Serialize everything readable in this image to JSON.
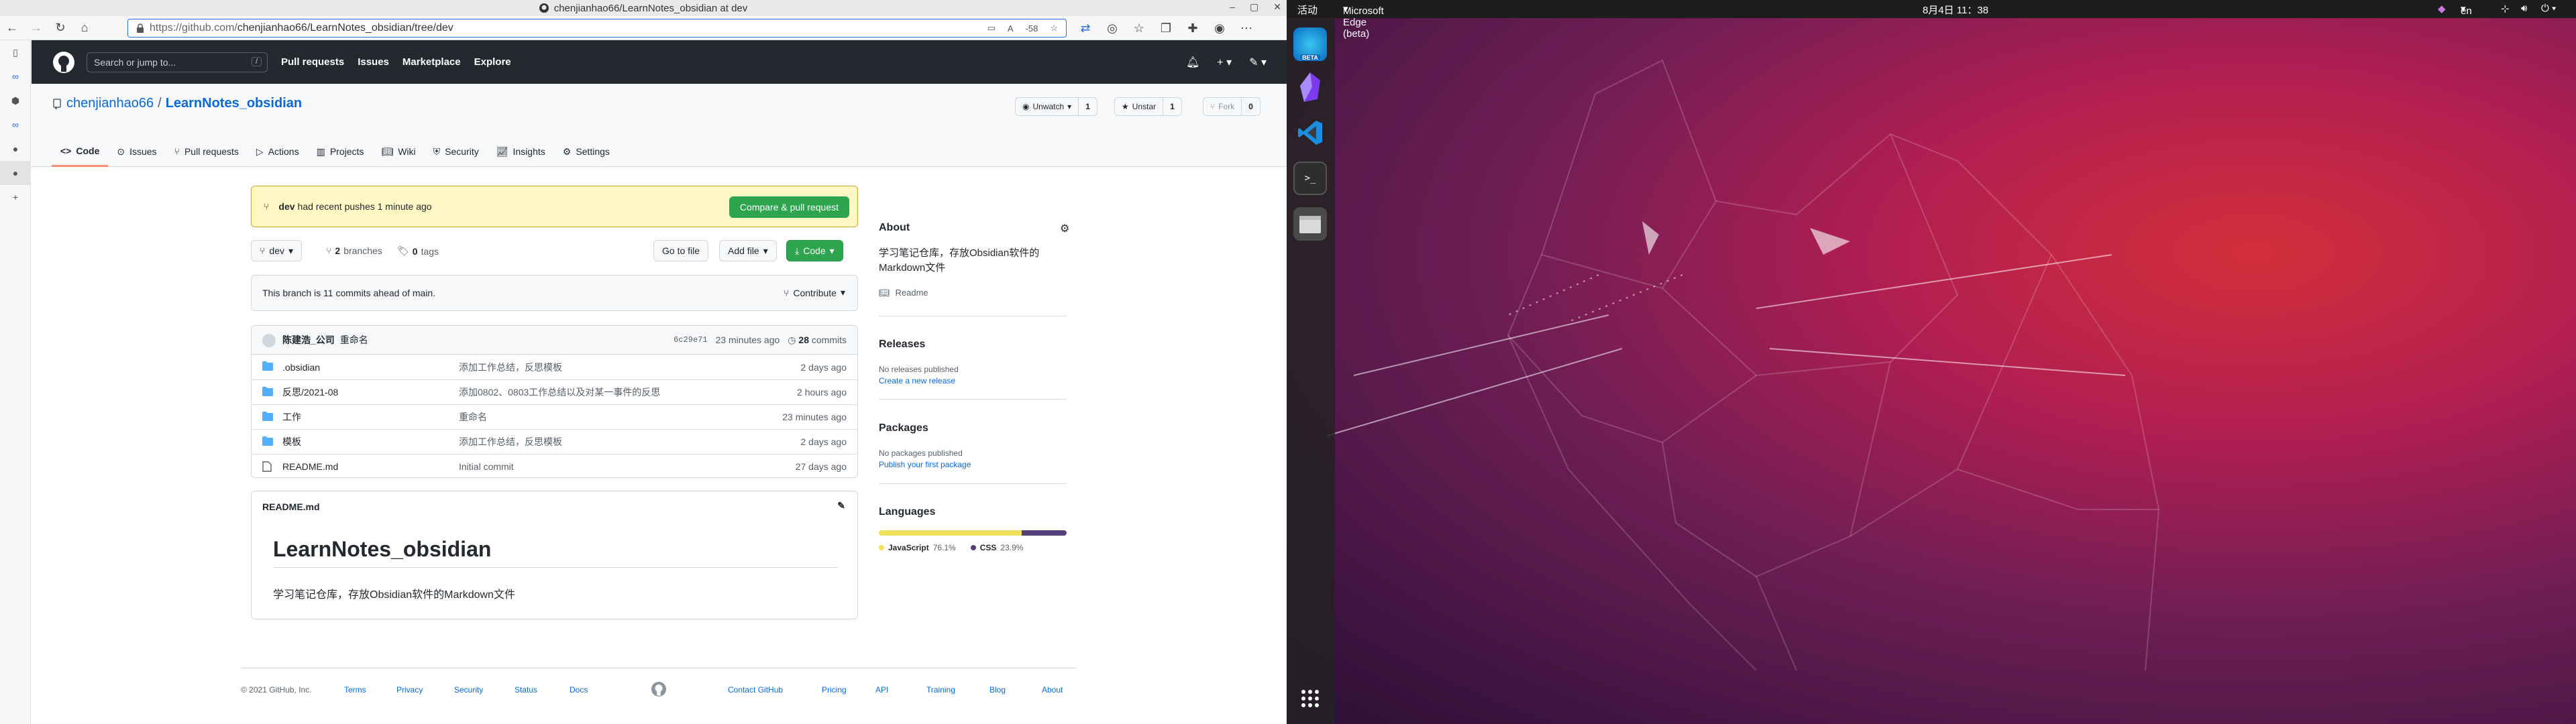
{
  "browser": {
    "window_title": "chenjianhao66/LearnNotes_obsidian at dev",
    "url_host": "https://github.com/",
    "url_path": "chenjianhao66/LearnNotes_obsidian/tree/dev",
    "zoom": "-58"
  },
  "gh": {
    "search_placeholder": "Search or jump to...",
    "search_key": "/",
    "nav": [
      "Pull requests",
      "Issues",
      "Marketplace",
      "Explore"
    ]
  },
  "repo": {
    "owner": "chenjianhao66",
    "sep": "/",
    "name": "LearnNotes_obsidian",
    "unwatch_label": "Unwatch",
    "unwatch_count": "1",
    "unstar_label": "Unstar",
    "unstar_count": "1",
    "fork_label": "Fork",
    "fork_count": "0",
    "tabs": [
      "Code",
      "Issues",
      "Pull requests",
      "Actions",
      "Projects",
      "Wiki",
      "Security",
      "Insights",
      "Settings"
    ]
  },
  "push": {
    "branch": "dev",
    "message": "had recent pushes 1 minute ago",
    "button": "Compare & pull request"
  },
  "branchbar": {
    "branch": "dev",
    "branches_count": "2",
    "branches_label": "branches",
    "tags_count": "0",
    "tags_label": "tags",
    "go_to_file": "Go to file",
    "add_file": "Add file",
    "code": "Code"
  },
  "ahead": {
    "text": "This branch is 11 commits ahead of main.",
    "contribute": "Contribute"
  },
  "last_commit": {
    "author": "陈建浩_公司",
    "message": "重命名",
    "sha": "6c29e71",
    "time": "23 minutes ago",
    "count": "28",
    "count_label": "commits"
  },
  "files": [
    {
      "type": "dir",
      "name": ".obsidian",
      "message": "添加工作总结，反思模板",
      "time": "2 days ago"
    },
    {
      "type": "dir",
      "name": "反思/2021-08",
      "message": "添加0802、0803工作总结以及对某一事件的反思",
      "time": "2 hours ago"
    },
    {
      "type": "dir",
      "name": "工作",
      "message": "重命名",
      "time": "23 minutes ago"
    },
    {
      "type": "dir",
      "name": "模板",
      "message": "添加工作总结，反思模板",
      "time": "2 days ago"
    },
    {
      "type": "file",
      "name": "README.md",
      "message": "Initial commit",
      "time": "27 days ago"
    }
  ],
  "readme": {
    "filename": "README.md",
    "title": "LearnNotes_obsidian",
    "body": "学习笔记仓库，存放Obsidian软件的Markdown文件"
  },
  "about": {
    "heading": "About",
    "description": "学习笔记仓库，存放Obsidian软件的Markdown文件",
    "readme_link": "Readme",
    "releases_heading": "Releases",
    "releases_text": "No releases published",
    "releases_link": "Create a new release",
    "packages_heading": "Packages",
    "packages_text": "No packages published",
    "packages_link": "Publish your first package",
    "languages_heading": "Languages",
    "languages": [
      {
        "name": "JavaScript",
        "percent": "76.1%",
        "value": 76.1,
        "color": "#f1e05a"
      },
      {
        "name": "CSS",
        "percent": "23.9%",
        "value": 23.9,
        "color": "#563d7c"
      }
    ]
  },
  "footer": {
    "copyright": "© 2021 GitHub, Inc.",
    "links": [
      "Terms",
      "Privacy",
      "Security",
      "Status",
      "Docs",
      "Contact GitHub",
      "Pricing",
      "API",
      "Training",
      "Blog",
      "About"
    ]
  },
  "desktop": {
    "activities": "活动",
    "app_menu": "Microsoft Edge (beta)",
    "clock": "8月4日 11：38",
    "lang": "en",
    "dock_badge": "BETA"
  },
  "colors": {
    "accent": "#0969da",
    "green": "#2da44e",
    "header": "#24292f",
    "tab_underline": "#fd8c73"
  }
}
